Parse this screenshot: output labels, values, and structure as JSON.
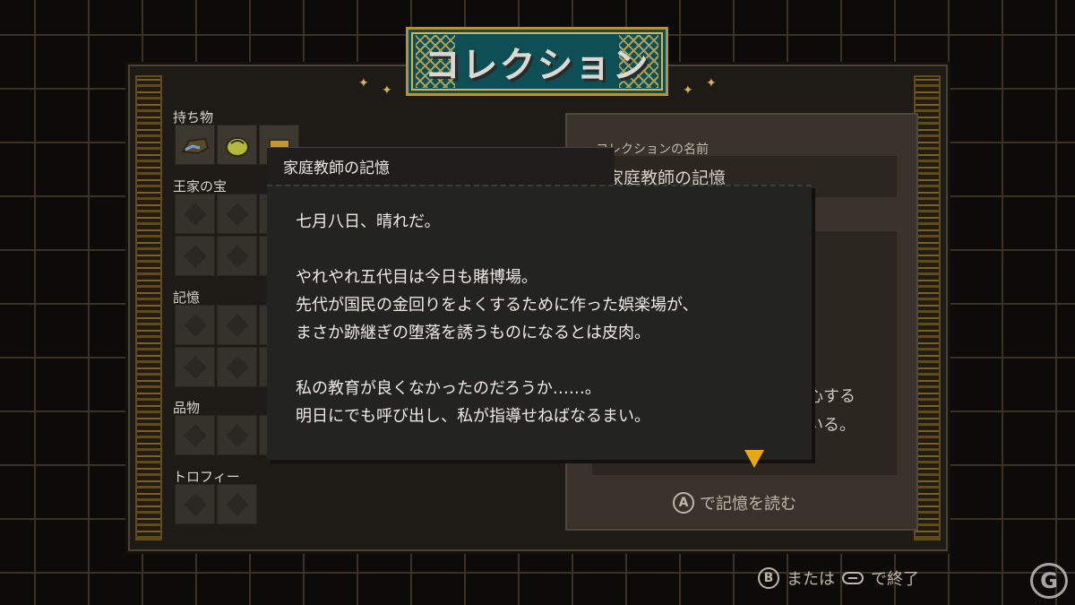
{
  "title": "コレクション",
  "sections": {
    "belongings": "持ち物",
    "royal_treasure": "王家の宝",
    "memories": "記憶",
    "goods": "品物",
    "trophies": "トロフィー"
  },
  "detail": {
    "name_label": "コレクションの名前",
    "name_value": "家庭教師の記憶",
    "desc_fragment_1": "心する",
    "desc_fragment_2": "ている。",
    "action_button": "A",
    "action_label": "で記憶を読む"
  },
  "popup": {
    "title": "家庭教師の記憶",
    "lines": [
      "七月八日、晴れだ。",
      "",
      "やれやれ五代目は今日も賭博場。",
      "先代が国民の金回りをよくするために作った娯楽場が、",
      "まさか跡継ぎの堕落を誘うものになるとは皮肉。",
      "",
      "私の教育が良くなかったのだろうか……。",
      "明日にでも呼び出し、私が指導せねばなるまい。"
    ]
  },
  "footer": {
    "back_button": "B",
    "or_text": "または",
    "exit_text": "で終了"
  },
  "colors": {
    "accent_gold": "#d8b256",
    "banner_teal": "#0e4f55",
    "advance_arrow": "#e8a714"
  }
}
